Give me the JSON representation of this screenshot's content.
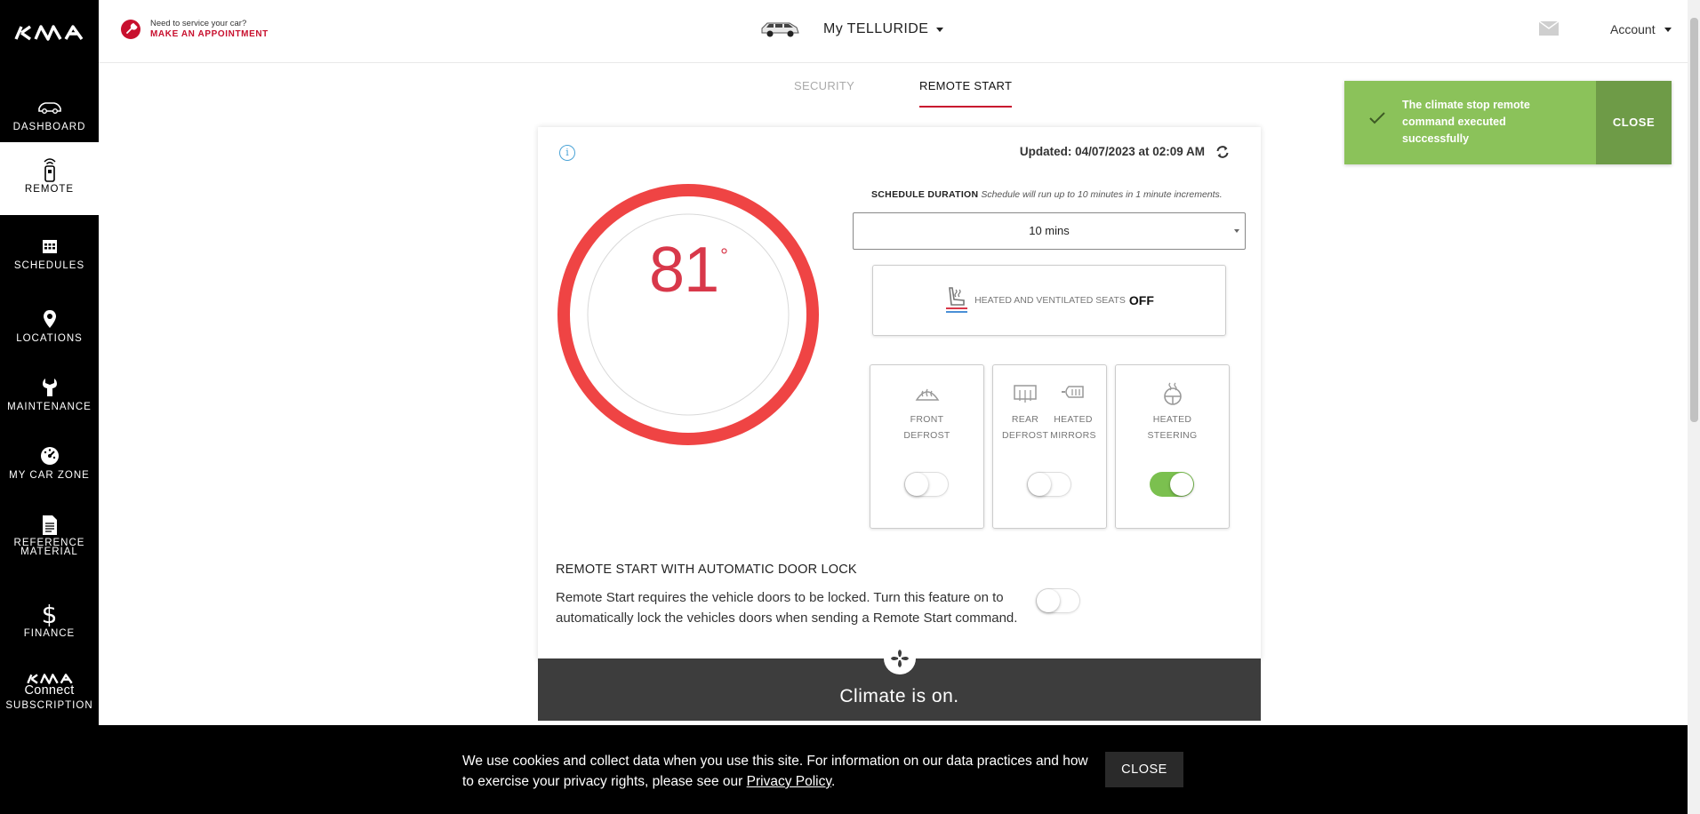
{
  "sidebar": {
    "items": [
      {
        "label": "DASHBOARD",
        "icon": "car-icon"
      },
      {
        "label": "REMOTE",
        "icon": "remote-key-icon",
        "active": true
      },
      {
        "label": "SCHEDULES",
        "icon": "calendar-icon"
      },
      {
        "label": "LOCATIONS",
        "icon": "location-pin-icon"
      },
      {
        "label": "MAINTENANCE",
        "icon": "wrench-icon"
      },
      {
        "label": "MY CAR ZONE",
        "icon": "speedometer-icon"
      },
      {
        "label_line1": "REFERENCE",
        "label_line2": "MATERIAL",
        "icon": "document-icon"
      },
      {
        "label": "FINANCE",
        "icon": "dollar-icon"
      },
      {
        "label_line1": "Connect",
        "label_line2": "SUBSCRIPTION",
        "icon": "kia-logo-icon"
      }
    ]
  },
  "header": {
    "service_question": "Need to service your car?",
    "service_action": "MAKE AN APPOINTMENT",
    "vehicle_name": "My TELLURIDE",
    "account_label": "Account"
  },
  "tabs": [
    {
      "label": "SECURITY",
      "active": false
    },
    {
      "label": "REMOTE START",
      "active": true
    }
  ],
  "card": {
    "updated_text": "Updated: 04/07/2023 at 02:09 AM",
    "temperature": "81",
    "degree_symbol": "°",
    "schedule_title": "SCHEDULE DURATION",
    "schedule_note": "Schedule will run up to 10 minutes in 1 minute increments.",
    "duration_selected": "10 mins",
    "seats_label": "HEATED AND VENTILATED SEATS",
    "seats_value": "OFF",
    "front_defrost": {
      "line1": "FRONT",
      "line2": "DEFROST",
      "on": false
    },
    "rear_defrost": {
      "line1": "REAR",
      "line2": "DEFROST"
    },
    "heated_mirrors": {
      "line1": "HEATED",
      "line2": "MIRRORS"
    },
    "rear_defrost_mirrors_on": false,
    "heated_steering": {
      "line1": "HEATED",
      "line2": "STEERING",
      "on": true
    },
    "door_lock_title": "REMOTE START WITH AUTOMATIC DOOR LOCK",
    "door_lock_desc": "Remote Start requires the vehicle doors to be locked. Turn this feature on to automatically lock the vehicles doors when sending a Remote Start command.",
    "door_lock_on": false,
    "climate_status": "Climate is on."
  },
  "toast": {
    "message": "The climate stop remote command executed successfully",
    "close_label": "CLOSE"
  },
  "cookie": {
    "text": "We use cookies and collect data when you use this site. For information on our data practices and how to exercise your privacy rights, please see our",
    "link": "Privacy Policy",
    "period": ".",
    "close_label": "CLOSE"
  },
  "colors": {
    "brand_red": "#c8102e",
    "gauge_red": "#ef4444",
    "toggle_on": "#7bc04f",
    "toast_green": "#8bc25a",
    "toast_close": "#6e9b47"
  }
}
